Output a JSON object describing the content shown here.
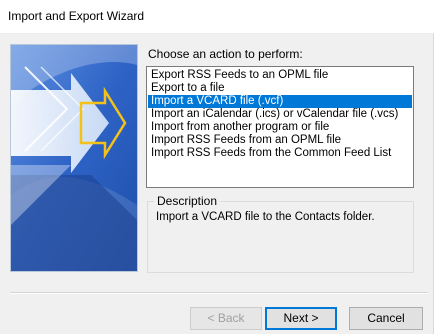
{
  "window": {
    "title": "Import and Export Wizard"
  },
  "main": {
    "prompt": "Choose an action to perform:",
    "actions": [
      "Export RSS Feeds to an OPML file",
      "Export to a file",
      "Import a VCARD file (.vcf)",
      "Import an iCalendar (.ics) or vCalendar file (.vcs)",
      "Import from another program or file",
      "Import RSS Feeds from an OPML file",
      "Import RSS Feeds from the Common Feed List"
    ],
    "selected_action": "Import a VCARD file (.vcf)",
    "description_label": "Description",
    "description_text": "Import a VCARD file to the Contacts folder."
  },
  "footer": {
    "back_label": "< Back",
    "back_enabled": false,
    "next_label": "Next >",
    "cancel_label": "Cancel"
  },
  "colors": {
    "selection": "#0078d7",
    "banner_blue": "#2f63c4",
    "arrow_yellow": "#f2c21a"
  },
  "icons": {
    "banner": "import-export-arrows-banner-graphic"
  }
}
